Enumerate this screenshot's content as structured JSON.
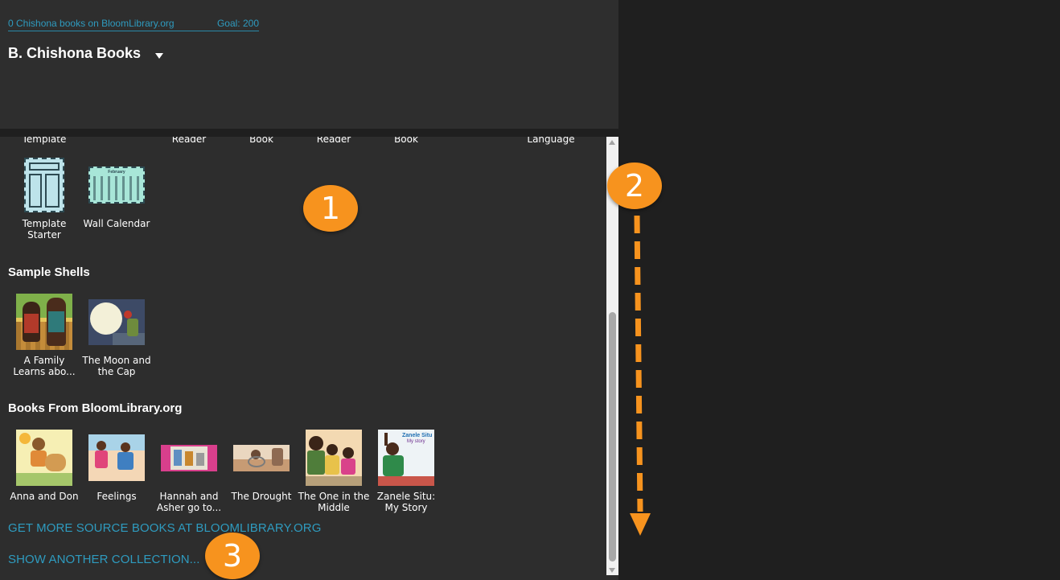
{
  "header": {
    "books_count": "0 Chishona books on BloomLibrary.org",
    "goal": "Goal: 200",
    "collection_title": "B. Chishona Books"
  },
  "cut_labels": [
    {
      "label": "Template"
    },
    {
      "label": "Reader"
    },
    {
      "label": "Book"
    },
    {
      "label": "Reader"
    },
    {
      "label": "Book"
    },
    {
      "label": "Language"
    }
  ],
  "templates": [
    {
      "label": "Template Starter"
    },
    {
      "label": "Wall Calendar"
    }
  ],
  "sample_shells": {
    "heading": "Sample Shells",
    "items": [
      {
        "label": "A Family Learns abo..."
      },
      {
        "label": "The Moon and the Cap"
      }
    ]
  },
  "bloom_books": {
    "heading": "Books From BloomLibrary.org",
    "items": [
      {
        "label": "Anna and Don"
      },
      {
        "label": "Feelings"
      },
      {
        "label": "Hannah and Asher go to..."
      },
      {
        "label": "The Drought"
      },
      {
        "label": "The One in the Middle"
      },
      {
        "label": "Zanele Situ: My Story"
      }
    ]
  },
  "links": {
    "get_more": "GET MORE SOURCE BOOKS AT BLOOMLIBRARY.ORG",
    "show_another": "SHOW ANOTHER COLLECTION..."
  },
  "calendar_month": "February",
  "zanele_cover_title": "Zanele Situ",
  "zanele_cover_subtitle": "My story",
  "callouts": [
    "1",
    "2",
    "3"
  ],
  "colors": {
    "accent_link": "#2e9bbf",
    "callout": "#f7931e",
    "panel_bg": "#2d2d2d",
    "outer_bg": "#1f1f1f"
  }
}
